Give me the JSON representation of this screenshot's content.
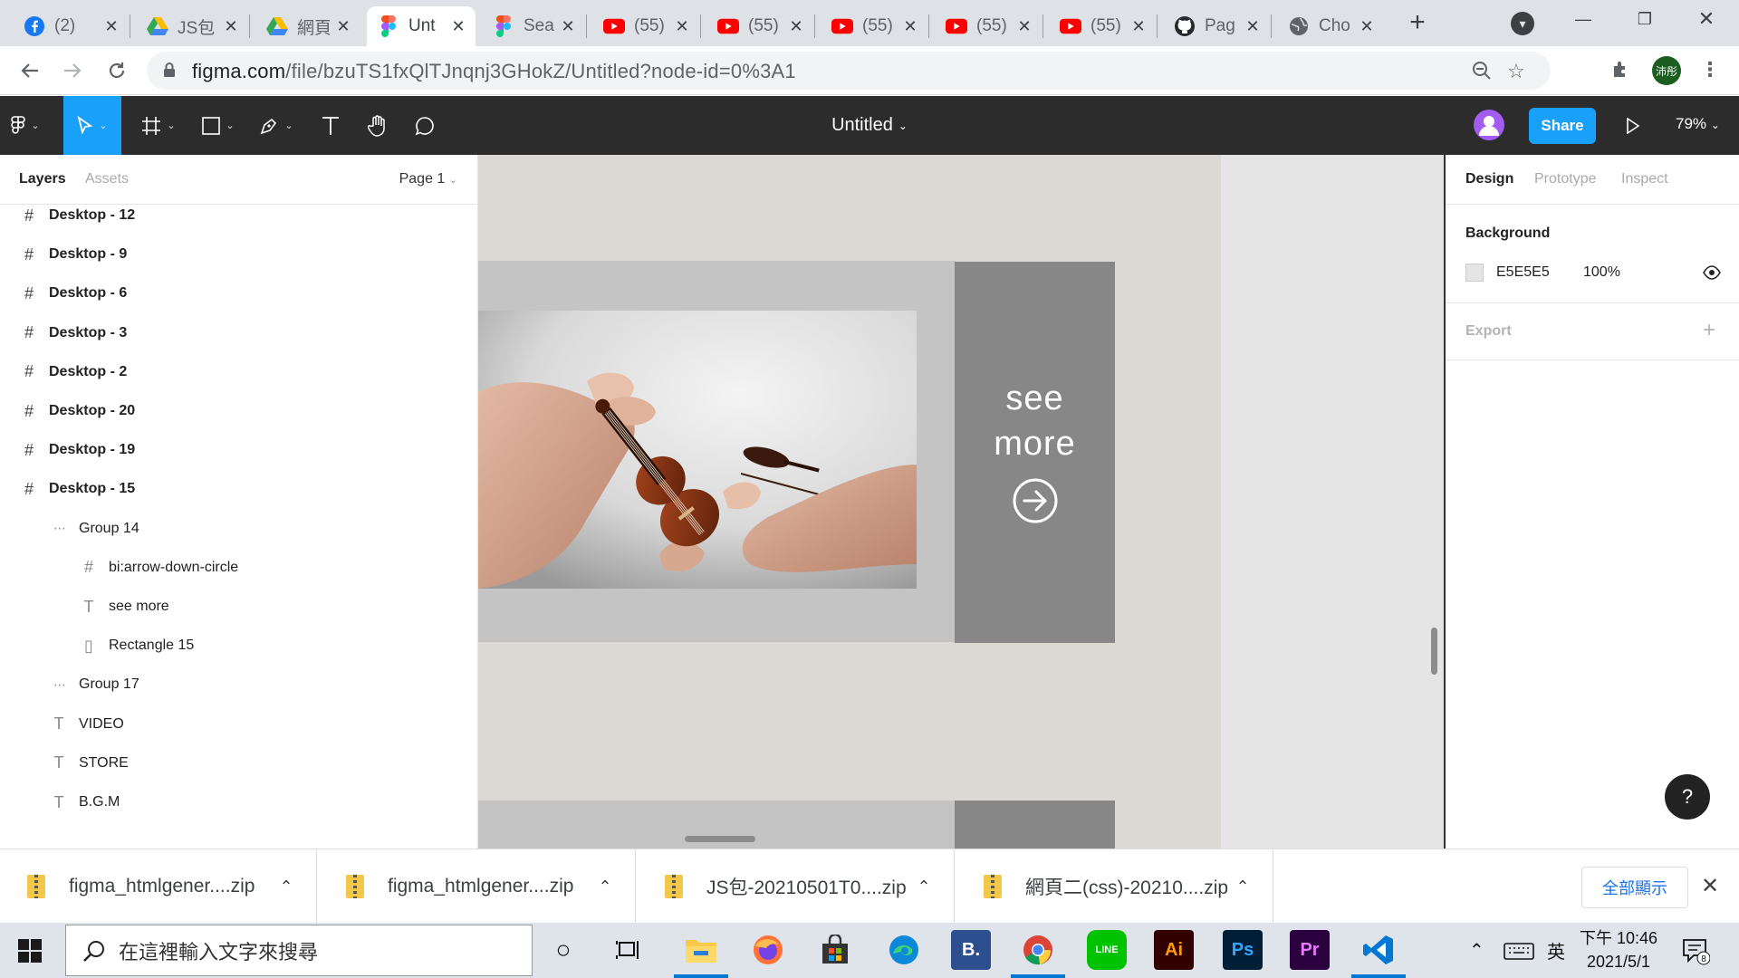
{
  "browser": {
    "tabs": [
      {
        "title": "(2) ",
        "icon": "facebook-icon",
        "color": "#1877f2"
      },
      {
        "title": "JS包",
        "icon": "google-drive-icon",
        "color": "#34a853"
      },
      {
        "title": "網頁",
        "icon": "google-drive-icon",
        "color": "#34a853"
      },
      {
        "title": "Unt",
        "icon": "figma-icon",
        "color": "#f24e1e",
        "active": true
      },
      {
        "title": "Sea",
        "icon": "figma-icon",
        "color": "#f24e1e"
      },
      {
        "title": "(55)",
        "icon": "youtube-icon",
        "color": "#ff0000"
      },
      {
        "title": "(55)",
        "icon": "youtube-icon",
        "color": "#ff0000"
      },
      {
        "title": "(55)",
        "icon": "youtube-icon",
        "color": "#ff0000"
      },
      {
        "title": "(55)",
        "icon": "youtube-icon",
        "color": "#ff0000"
      },
      {
        "title": "(55)",
        "icon": "youtube-icon",
        "color": "#ff0000"
      },
      {
        "title": "Pag",
        "icon": "github-icon",
        "color": "#24292e"
      },
      {
        "title": "Cho",
        "icon": "globe-icon",
        "color": "#5f6368"
      }
    ],
    "url_host": "figma.com",
    "url_path": "/file/bzuTS1fxQlTJnqnj3GHokZ/Untitled?node-id=0%3A1",
    "profile_initials": "沛彤"
  },
  "figma": {
    "doc_title": "Untitled",
    "share_label": "Share",
    "zoom": "79%",
    "left_tabs": {
      "layers": "Layers",
      "assets": "Assets"
    },
    "page_selector": "Page 1",
    "layers": [
      {
        "name": "Desktop - 12",
        "type": "frame",
        "depth": 0
      },
      {
        "name": "Desktop - 9",
        "type": "frame",
        "depth": 0
      },
      {
        "name": "Desktop - 6",
        "type": "frame",
        "depth": 0
      },
      {
        "name": "Desktop - 3",
        "type": "frame",
        "depth": 0
      },
      {
        "name": "Desktop - 2",
        "type": "frame",
        "depth": 0
      },
      {
        "name": "Desktop - 20",
        "type": "frame",
        "depth": 0
      },
      {
        "name": "Desktop - 19",
        "type": "frame",
        "depth": 0
      },
      {
        "name": "Desktop - 15",
        "type": "frame",
        "depth": 0
      },
      {
        "name": "Group 14",
        "type": "group",
        "depth": 1
      },
      {
        "name": "bi:arrow-down-circle",
        "type": "frame",
        "depth": 2
      },
      {
        "name": "see more",
        "type": "text",
        "depth": 2
      },
      {
        "name": "Rectangle 15",
        "type": "rect",
        "depth": 2
      },
      {
        "name": "Group 17",
        "type": "group",
        "depth": 1
      },
      {
        "name": "VIDEO",
        "type": "text",
        "depth": 1
      },
      {
        "name": "STORE",
        "type": "text",
        "depth": 1
      },
      {
        "name": "B.G.M",
        "type": "text",
        "depth": 1
      }
    ],
    "canvas": {
      "see_more_line1": "see",
      "see_more_line2": "more"
    },
    "right_tabs": {
      "design": "Design",
      "prototype": "Prototype",
      "inspect": "Inspect"
    },
    "background": {
      "label": "Background",
      "hex": "E5E5E5",
      "opacity": "100%",
      "color": "#e5e5e5"
    },
    "export_label": "Export",
    "help_label": "?"
  },
  "downloads": {
    "items": [
      "figma_htmlgener....zip",
      "figma_htmlgener....zip",
      "JS包-20210501T0....zip",
      "網頁二(css)-20210....zip"
    ],
    "show_all": "全部顯示"
  },
  "taskbar": {
    "search_placeholder": "在這裡輸入文字來搜尋",
    "ime": "英",
    "time": "下午 10:46",
    "date": "2021/5/1",
    "notification_count": "8",
    "apps": [
      {
        "name": "file-explorer",
        "label": ""
      },
      {
        "name": "firefox",
        "label": ""
      },
      {
        "name": "microsoft-store",
        "label": ""
      },
      {
        "name": "edge",
        "label": ""
      },
      {
        "name": "bootstrap-studio",
        "label": "B."
      },
      {
        "name": "chrome",
        "label": ""
      },
      {
        "name": "line",
        "label": "LINE"
      },
      {
        "name": "illustrator",
        "label": "Ai"
      },
      {
        "name": "photoshop",
        "label": "Ps"
      },
      {
        "name": "premiere",
        "label": "Pr"
      },
      {
        "name": "vscode",
        "label": ""
      }
    ]
  }
}
